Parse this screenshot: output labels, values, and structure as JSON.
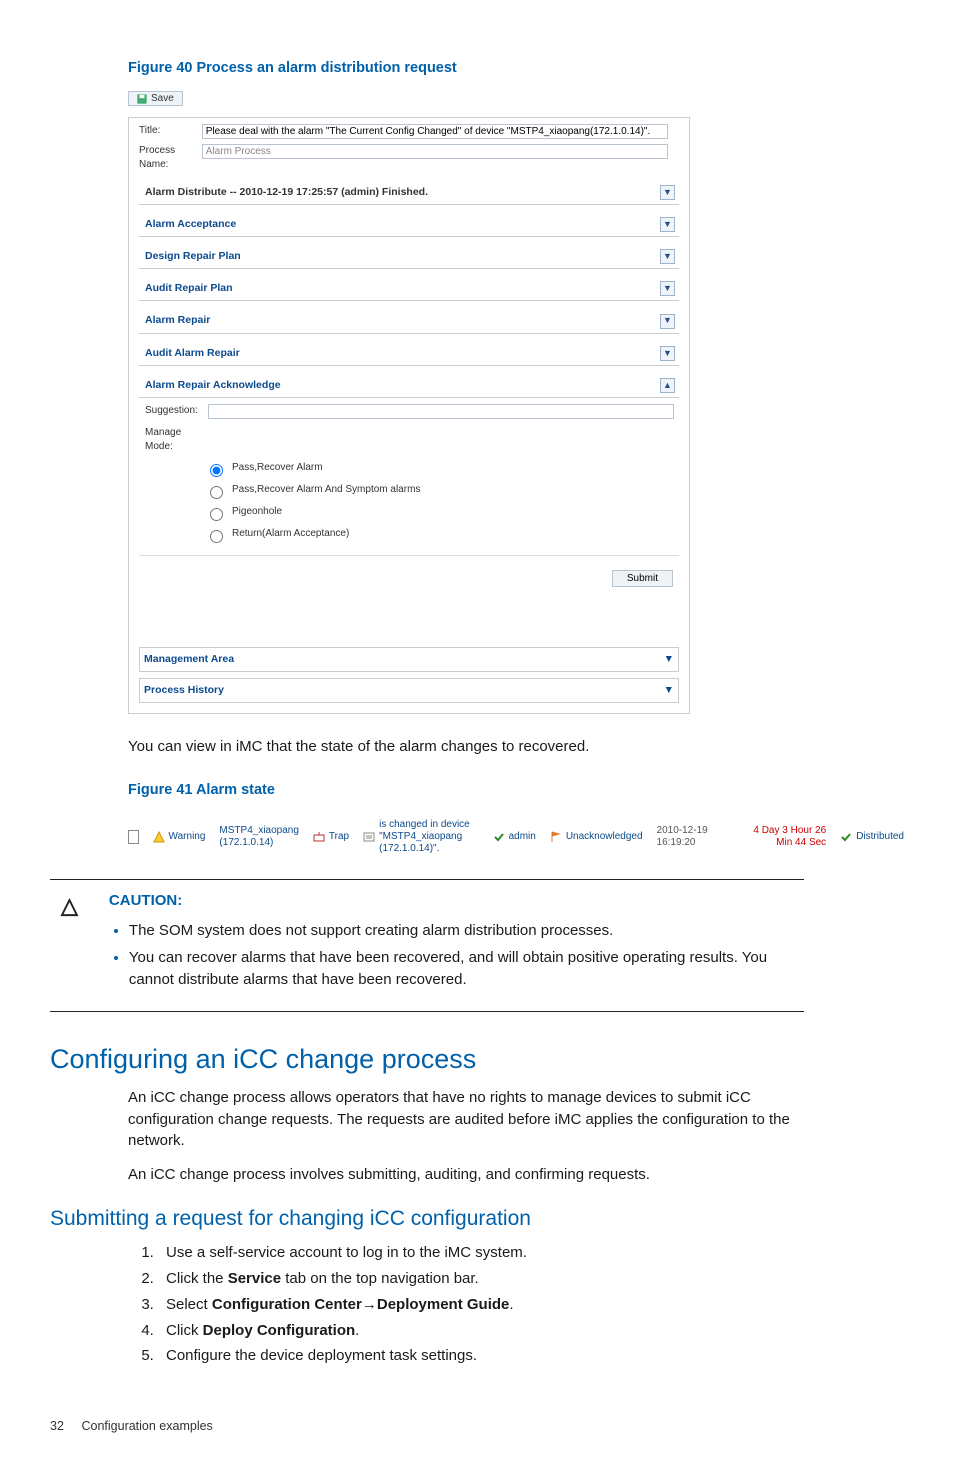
{
  "figure40": {
    "title": "Figure 40 Process an alarm distribution request",
    "save": "Save",
    "labels": {
      "title": "Title:",
      "process_name": "Process Name:"
    },
    "title_value": "Please deal with the alarm \"The Current Config Changed\" of device \"MSTP4_xiaopang(172.1.0.14)\".",
    "process_name_value": "Alarm Process",
    "panels": {
      "p1": "Alarm Distribute -- 2010-12-19 17:25:57 (admin) Finished.",
      "p2": "Alarm Acceptance",
      "p3": "Design Repair Plan",
      "p4": "Audit Repair Plan",
      "p5": "Alarm Repair",
      "p6": "Audit Alarm Repair",
      "p7": "Alarm Repair Acknowledge"
    },
    "ack": {
      "suggestion_label": "Suggestion:",
      "manage_mode_label": "Manage Mode:",
      "opt1": "Pass,Recover Alarm",
      "opt2": "Pass,Recover Alarm And Symptom alarms",
      "opt3": "Pigeonhole",
      "opt4": "Return(Alarm Acceptance)"
    },
    "submit": "Submit",
    "bottom1": "Management Area",
    "bottom2": "Process History"
  },
  "body1": "You can view in iMC that the state of the alarm changes to recovered.",
  "figure41": {
    "title": "Figure 41 Alarm state",
    "row": {
      "severity": "Warning",
      "device_name": "MSTP4_xiaopang",
      "device_ip": "(172.1.0.14)",
      "type": "Trap",
      "desc1": "is changed in device",
      "desc2": "\"MSTP4_xiaopang (172.1.0.14)\".",
      "user": "admin",
      "ack": "Unacknowledged",
      "time": "2010-12-19 16:19:20",
      "duration": "4 Day 3 Hour 26 Min 44 Sec",
      "dist": "Distributed"
    }
  },
  "caution": {
    "title": "CAUTION:",
    "item1": "The SOM system does not support creating alarm distribution processes.",
    "item2": "You can recover alarms that have been recovered, and will obtain positive operating results. You cannot distribute alarms that have been recovered."
  },
  "h1": "Configuring an iCC change process",
  "para1": "An iCC change process allows operators that have no rights to manage devices to submit iCC configuration change requests. The requests are audited before iMC applies the configuration to the network.",
  "para2": "An iCC change process involves submitting, auditing, and confirming requests.",
  "h2": "Submitting a request for changing iCC configuration",
  "steps": {
    "s1": "Use a self-service account to log in to the iMC system.",
    "s2a": "Click the ",
    "s2b": "Service",
    "s2c": " tab on the top navigation bar.",
    "s3a": "Select ",
    "s3b": "Configuration Center",
    "s3c": "Deployment Guide",
    "s4a": "Click ",
    "s4b": "Deploy Configuration",
    "s5": "Configure the device deployment task settings."
  },
  "footer": {
    "page": "32",
    "label": "Configuration examples"
  }
}
